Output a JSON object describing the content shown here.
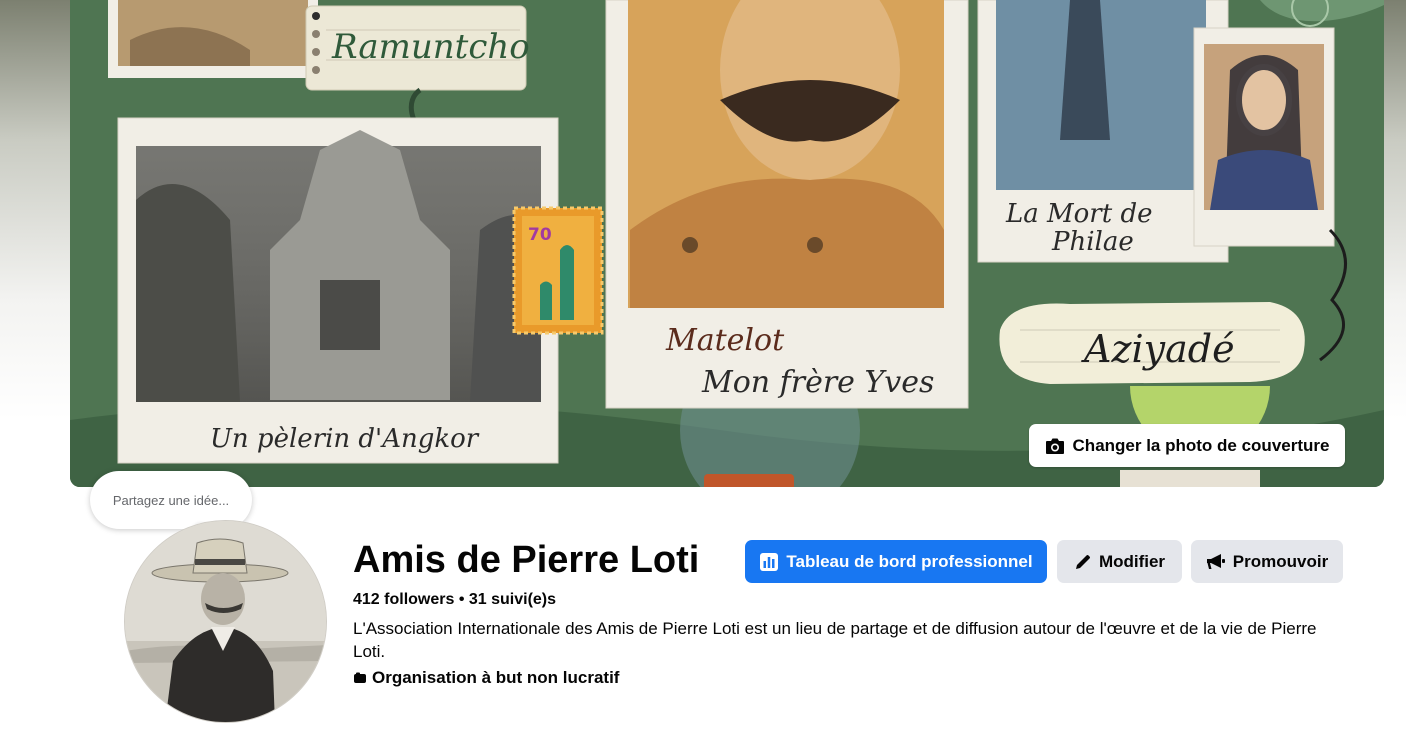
{
  "cover": {
    "change_photo_label": "Changer la photo de couverture",
    "captions": {
      "ramuntcho": "Ramuntcho",
      "angkor": "Un pèlerin d'Angkor",
      "matelot_line1": "Matelot",
      "matelot_line2": "Mon frère Yves",
      "philae_line1": "La Mort de",
      "philae_line2": "Philae",
      "aziyade": "Aziyadé",
      "stamp_value": "70"
    }
  },
  "thought_bubble": {
    "placeholder": "Partagez une idée..."
  },
  "profile": {
    "name": "Amis de Pierre Loti",
    "stats": "412 followers • 31 suivi(e)s",
    "bio": "L'Association Internationale des Amis de Pierre Loti est un lieu de partage et de diffusion autour de l'œuvre et de la vie de Pierre Loti.",
    "category": "Organisation à but non lucratif"
  },
  "actions": {
    "dashboard_label": "Tableau de bord professionnel",
    "edit_label": "Modifier",
    "promote_label": "Promouvoir"
  },
  "colors": {
    "primary": "#1877f2",
    "secondary_button": "#e4e6eb",
    "cover_green": "#4f7552"
  },
  "icons": {
    "camera": "camera-icon",
    "dashboard": "bar-chart-icon",
    "edit": "pencil-icon",
    "promote": "megaphone-icon",
    "category": "category-icon"
  }
}
